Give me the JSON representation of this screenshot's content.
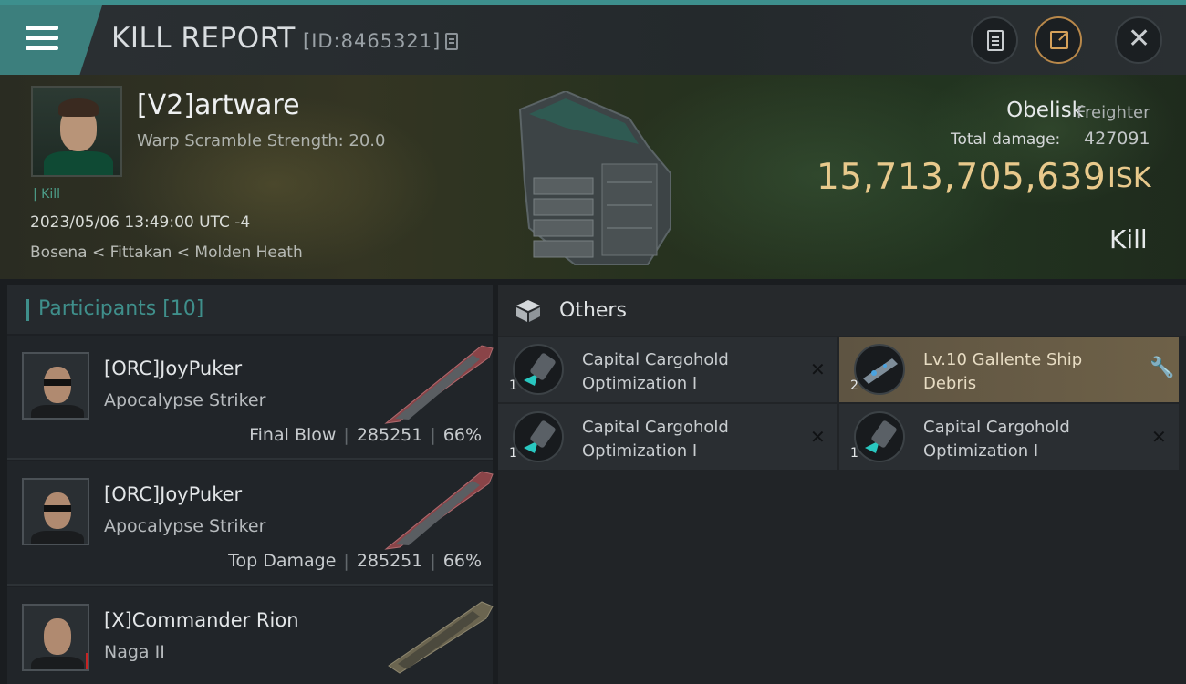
{
  "header": {
    "title": "KILL REPORT",
    "report_id": "[ID:8465321]"
  },
  "victim": {
    "name": "[V2]artware",
    "warp_scramble": "Warp Scramble Strength: 20.0",
    "tag": "| Kill",
    "datetime": "2023/05/06 13:49:00 UTC -4",
    "location": "Bosena < Fittakan < Molden Heath"
  },
  "ship": {
    "name": "Obelisk",
    "class": "Freighter",
    "total_damage_label": "Total damage:",
    "total_damage_value": "427091",
    "isk_value": "15,713,705,639",
    "isk_unit": "ISK",
    "result": "Kill"
  },
  "participants": {
    "title": "Participants [10]",
    "rows": [
      {
        "name": "[ORC]JoyPuker",
        "ship": "Apocalypse Striker",
        "role": "Final Blow",
        "damage": "285251",
        "percent": "66%"
      },
      {
        "name": "[ORC]JoyPuker",
        "ship": "Apocalypse Striker",
        "role": "Top Damage",
        "damage": "285251",
        "percent": "66%"
      },
      {
        "name": "[X]Commander Rion",
        "ship": "Naga II",
        "role": "",
        "damage": "",
        "percent": ""
      }
    ]
  },
  "others": {
    "title": "Others",
    "items": [
      {
        "qty": "1",
        "name": "Capital Cargohold Optimization I",
        "status": "destroyed"
      },
      {
        "qty": "2",
        "name": "Lv.10 Gallente Ship Debris",
        "status": "dropped"
      },
      {
        "qty": "1",
        "name": "Capital Cargohold Optimization I",
        "status": "destroyed"
      },
      {
        "qty": "1",
        "name": "Capital Cargohold Optimization I",
        "status": "destroyed"
      }
    ]
  },
  "colors": {
    "accent": "#3f8f8b",
    "isk": "#e8c98c",
    "highlight": "#6e6148"
  },
  "icons": [
    "menu-icon",
    "copy-icon",
    "document-icon",
    "share-icon",
    "close-icon",
    "cube-icon",
    "x-icon",
    "wrench-icon"
  ]
}
